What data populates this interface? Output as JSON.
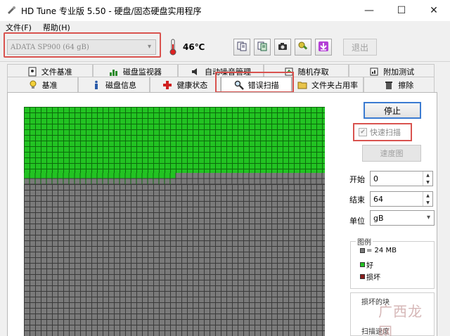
{
  "window": {
    "title": "HD Tune 专业版 5.50 - 硬盘/固态硬盘实用程序",
    "minimize": "—",
    "maximize": "☐",
    "close": "✕"
  },
  "menu": {
    "items": [
      "文件(F)",
      "帮助(H)"
    ]
  },
  "toolbar": {
    "drive": "ADATA SP900 (64 gB)",
    "temperature": "46℃",
    "exit_label": "退出"
  },
  "tabs": {
    "row1": [
      "文件基准",
      "磁盘监视器",
      "自动噪音管理",
      "随机存取",
      "附加测试"
    ],
    "row2": [
      "基准",
      "磁盘信息",
      "健康状态",
      "错误扫描",
      "文件夹占用率",
      "擦除"
    ],
    "active": "错误扫描"
  },
  "scan": {
    "stop_label": "停止",
    "quick_scan_label": "快速扫描",
    "quick_scan_checked": true,
    "speed_map_label": "速度图",
    "start_label": "开始",
    "start_value": "0",
    "end_label": "结束",
    "end_value": "64",
    "unit_label": "单位",
    "unit_value": "gB",
    "progress_fraction": 0.31
  },
  "legend": {
    "title": "图例",
    "block_size": "= 24 MB",
    "good": "好",
    "damaged": "损坏"
  },
  "stats": {
    "damaged_blocks": "损坏的块",
    "scan_speed": "扫描速度"
  },
  "colors": {
    "good": "#22c322",
    "unscanned": "#7a7a7a",
    "damaged": "#8b1c1c",
    "highlight": "#d9534f"
  },
  "watermark": "广西龙网"
}
